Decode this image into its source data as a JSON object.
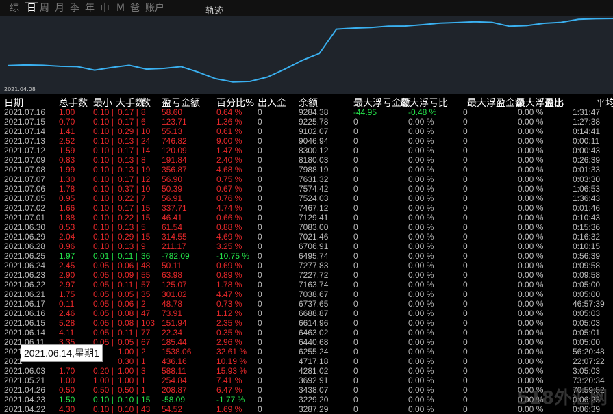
{
  "tabs": [
    "综",
    "日",
    "周",
    "月",
    "季",
    "年",
    "巾",
    "M",
    "爸",
    "账户"
  ],
  "active_tab": 1,
  "chart_title": "轨迹",
  "chart_date_label": "2021.04.08",
  "chart_data": {
    "type": "line",
    "color": "#3ab0f0",
    "x": [
      "2021.04.08",
      "",
      "",
      "",
      "",
      "",
      "",
      "",
      "",
      "",
      "",
      "",
      "",
      "",
      "",
      "",
      "",
      "",
      "",
      "",
      "",
      "",
      "",
      "",
      "",
      "",
      "",
      "",
      "",
      "",
      "",
      "",
      "",
      "",
      "",
      ""
    ],
    "values": [
      3287,
      3320,
      3300,
      3250,
      3230,
      3050,
      3190,
      3300,
      3100,
      3140,
      3230,
      2950,
      2620,
      2450,
      2480,
      2700,
      3100,
      3550,
      3900,
      5150,
      5200,
      5230,
      5300,
      5310,
      5380,
      5460,
      5490,
      5530,
      5500,
      5300,
      5330,
      5450,
      5500,
      5650,
      5680,
      5690
    ]
  },
  "columns": [
    "日期",
    "总手数",
    "最小",
    "大手数",
    "数",
    "盈亏金额",
    "百分比%",
    "出入金",
    "余额",
    "最大浮亏金额",
    "最大浮亏比",
    "最大浮盈金额",
    "最大浮盈比",
    "最小",
    "平均"
  ],
  "rows": [
    {
      "date": "2021.07.16",
      "lots": "1.00",
      "min": "0.10",
      "max": "0.17",
      "n": "8",
      "pl": "58.60",
      "pct": "0.64 %",
      "io": "0",
      "bal": "9284.38",
      "mfl": "-44.95",
      "mflp": "-0.48 %",
      "mfp": "0",
      "mfpp": "0.00 %",
      "t": "1:31:47",
      "cls": "red",
      "mflcls": "green"
    },
    {
      "date": "2021.07.15",
      "lots": "0.70",
      "min": "0.10",
      "max": "0.17",
      "n": "6",
      "pl": "123.71",
      "pct": "1.36 %",
      "io": "0",
      "bal": "9225.78",
      "mfl": "0",
      "mflp": "0.00 %",
      "mfp": "0",
      "mfpp": "0.00 %",
      "t": "1:27:38",
      "cls": "red"
    },
    {
      "date": "2021.07.14",
      "lots": "1.41",
      "min": "0.10",
      "max": "0.29",
      "n": "10",
      "pl": "55.13",
      "pct": "0.61 %",
      "io": "0",
      "bal": "9102.07",
      "mfl": "0",
      "mflp": "0.00 %",
      "mfp": "0",
      "mfpp": "0.00 %",
      "t": "0:14:41",
      "cls": "red"
    },
    {
      "date": "2021.07.13",
      "lots": "2.52",
      "min": "0.10",
      "max": "0.13",
      "n": "24",
      "pl": "746.82",
      "pct": "9.00 %",
      "io": "0",
      "bal": "9046.94",
      "mfl": "0",
      "mflp": "0.00 %",
      "mfp": "0",
      "mfpp": "0.00 %",
      "t": "0:00:11",
      "cls": "red"
    },
    {
      "date": "2021.07.12",
      "lots": "1.59",
      "min": "0.10",
      "max": "0.17",
      "n": "14",
      "pl": "120.09",
      "pct": "1.47 %",
      "io": "0",
      "bal": "8300.12",
      "mfl": "0",
      "mflp": "0.00 %",
      "mfp": "0",
      "mfpp": "0.00 %",
      "t": "0:00:43",
      "cls": "red"
    },
    {
      "date": "2021.07.09",
      "lots": "0.83",
      "min": "0.10",
      "max": "0.13",
      "n": "8",
      "pl": "191.84",
      "pct": "2.40 %",
      "io": "0",
      "bal": "8180.03",
      "mfl": "0",
      "mflp": "0.00 %",
      "mfp": "0",
      "mfpp": "0.00 %",
      "t": "0:26:39",
      "cls": "red"
    },
    {
      "date": "2021.07.08",
      "lots": "1.99",
      "min": "0.10",
      "max": "0.13",
      "n": "19",
      "pl": "356.87",
      "pct": "4.68 %",
      "io": "0",
      "bal": "7988.19",
      "mfl": "0",
      "mflp": "0.00 %",
      "mfp": "0",
      "mfpp": "0.00 %",
      "t": "0:01:33",
      "cls": "red"
    },
    {
      "date": "2021.07.07",
      "lots": "1.30",
      "min": "0.10",
      "max": "0.17",
      "n": "12",
      "pl": "56.90",
      "pct": "0.75 %",
      "io": "0",
      "bal": "7631.32",
      "mfl": "0",
      "mflp": "0.00 %",
      "mfp": "0",
      "mfpp": "0.00 %",
      "t": "0:03:30",
      "cls": "red"
    },
    {
      "date": "2021.07.06",
      "lots": "1.78",
      "min": "0.10",
      "max": "0.37",
      "n": "10",
      "pl": "50.39",
      "pct": "0.67 %",
      "io": "0",
      "bal": "7574.42",
      "mfl": "0",
      "mflp": "0.00 %",
      "mfp": "0",
      "mfpp": "0.00 %",
      "t": "1:06:53",
      "cls": "red"
    },
    {
      "date": "2021.07.05",
      "lots": "0.95",
      "min": "0.10",
      "max": "0.22",
      "n": "7",
      "pl": "56.91",
      "pct": "0.76 %",
      "io": "0",
      "bal": "7524.03",
      "mfl": "0",
      "mflp": "0.00 %",
      "mfp": "0",
      "mfpp": "0.00 %",
      "t": "1:36:43",
      "cls": "red"
    },
    {
      "date": "2021.07.02",
      "lots": "1.66",
      "min": "0.10",
      "max": "0.17",
      "n": "15",
      "pl": "337.71",
      "pct": "4.74 %",
      "io": "0",
      "bal": "7467.12",
      "mfl": "0",
      "mflp": "0.00 %",
      "mfp": "0",
      "mfpp": "0.00 %",
      "t": "0:01:46",
      "cls": "red"
    },
    {
      "date": "2021.07.01",
      "lots": "1.88",
      "min": "0.10",
      "max": "0.22",
      "n": "15",
      "pl": "46.41",
      "pct": "0.66 %",
      "io": "0",
      "bal": "7129.41",
      "mfl": "0",
      "mflp": "0.00 %",
      "mfp": "0",
      "mfpp": "0.00 %",
      "t": "0:10:43",
      "cls": "red"
    },
    {
      "date": "2021.06.30",
      "lots": "0.53",
      "min": "0.10",
      "max": "0.13",
      "n": "5",
      "pl": "61.54",
      "pct": "0.88 %",
      "io": "0",
      "bal": "7083.00",
      "mfl": "0",
      "mflp": "0.00 %",
      "mfp": "0",
      "mfpp": "0.00 %",
      "t": "0:15:36",
      "cls": "red"
    },
    {
      "date": "2021.06.29",
      "lots": "2.04",
      "min": "0.10",
      "max": "0.29",
      "n": "15",
      "pl": "314.55",
      "pct": "4.69 %",
      "io": "0",
      "bal": "7021.46",
      "mfl": "0",
      "mflp": "0.00 %",
      "mfp": "0",
      "mfpp": "0.00 %",
      "t": "0:16:32",
      "cls": "red"
    },
    {
      "date": "2021.06.28",
      "lots": "0.96",
      "min": "0.10",
      "max": "0.13",
      "n": "9",
      "pl": "211.17",
      "pct": "3.25 %",
      "io": "0",
      "bal": "6706.91",
      "mfl": "0",
      "mflp": "0.00 %",
      "mfp": "0",
      "mfpp": "0.00 %",
      "t": "0:10:15",
      "cls": "red"
    },
    {
      "date": "2021.06.25",
      "lots": "1.97",
      "min": "0.01",
      "max": "0.11",
      "n": "36",
      "pl": "-782.09",
      "pct": "-10.75 %",
      "io": "0",
      "bal": "6495.74",
      "mfl": "0",
      "mflp": "0.00 %",
      "mfp": "0",
      "mfpp": "0.00 %",
      "t": "0:56:39",
      "cls": "green"
    },
    {
      "date": "2021.06.24",
      "lots": "2.45",
      "min": "0.05",
      "max": "0.06",
      "n": "48",
      "pl": "50.11",
      "pct": "0.69 %",
      "io": "0",
      "bal": "7277.83",
      "mfl": "0",
      "mflp": "0.00 %",
      "mfp": "0",
      "mfpp": "0.00 %",
      "t": "0:09:58",
      "cls": "red"
    },
    {
      "date": "2021.06.23",
      "lots": "2.90",
      "min": "0.05",
      "max": "0.09",
      "n": "55",
      "pl": "63.98",
      "pct": "0.89 %",
      "io": "0",
      "bal": "7227.72",
      "mfl": "0",
      "mflp": "0.00 %",
      "mfp": "0",
      "mfpp": "0.00 %",
      "t": "0:09:58",
      "cls": "red"
    },
    {
      "date": "2021.06.22",
      "lots": "2.97",
      "min": "0.05",
      "max": "0.11",
      "n": "57",
      "pl": "125.07",
      "pct": "1.78 %",
      "io": "0",
      "bal": "7163.74",
      "mfl": "0",
      "mflp": "0.00 %",
      "mfp": "0",
      "mfpp": "0.00 %",
      "t": "0:05:00",
      "cls": "red"
    },
    {
      "date": "2021.06.21",
      "lots": "1.75",
      "min": "0.05",
      "max": "0.05",
      "n": "35",
      "pl": "301.02",
      "pct": "4.47 %",
      "io": "0",
      "bal": "7038.67",
      "mfl": "0",
      "mflp": "0.00 %",
      "mfp": "0",
      "mfpp": "0.00 %",
      "t": "0:05:00",
      "cls": "red"
    },
    {
      "date": "2021.06.17",
      "lots": "0.11",
      "min": "0.05",
      "max": "0.06",
      "n": "2",
      "pl": "48.78",
      "pct": "0.73 %",
      "io": "0",
      "bal": "6737.65",
      "mfl": "0",
      "mflp": "0.00 %",
      "mfp": "0",
      "mfpp": "0.00 %",
      "t": "46:57:39",
      "cls": "red"
    },
    {
      "date": "2021.06.16",
      "lots": "2.46",
      "min": "0.05",
      "max": "0.08",
      "n": "47",
      "pl": "73.91",
      "pct": "1.12 %",
      "io": "0",
      "bal": "6688.87",
      "mfl": "0",
      "mflp": "0.00 %",
      "mfp": "0",
      "mfpp": "0.00 %",
      "t": "0:05:03",
      "cls": "red"
    },
    {
      "date": "2021.06.15",
      "lots": "5.28",
      "min": "0.05",
      "max": "0.08",
      "n": "103",
      "pl": "151.94",
      "pct": "2.35 %",
      "io": "0",
      "bal": "6614.96",
      "mfl": "0",
      "mflp": "0.00 %",
      "mfp": "0",
      "mfpp": "0.00 %",
      "t": "0:05:03",
      "cls": "red"
    },
    {
      "date": "2021.06.14",
      "lots": "4.11",
      "min": "0.05",
      "max": "0.11",
      "n": "77",
      "pl": "22.34",
      "pct": "0.35 %",
      "io": "0",
      "bal": "6463.02",
      "mfl": "0",
      "mflp": "0.00 %",
      "mfp": "0",
      "mfpp": "0.00 %",
      "t": "0:05:01",
      "cls": "red"
    },
    {
      "date": "2021.06.11",
      "lots": "3.35",
      "min": "0.05",
      "max": "0.05",
      "n": "67",
      "pl": "185.44",
      "pct": "2.96 %",
      "io": "0",
      "bal": "6440.68",
      "mfl": "0",
      "mflp": "0.00 %",
      "mfp": "0",
      "mfpp": "0.00 %",
      "t": "0:05:00",
      "cls": "red"
    },
    {
      "date": "2021",
      "lots": "",
      "min": "",
      "max": "1.00",
      "n": "2",
      "pl": "1538.06",
      "pct": "32.61 %",
      "io": "0",
      "bal": "6255.24",
      "mfl": "0",
      "mflp": "0.00 %",
      "mfp": "0",
      "mfpp": "0.00 %",
      "t": "56:20:48",
      "cls": "red"
    },
    {
      "date": "2021",
      "lots": "",
      "min": "",
      "max": "0.30",
      "n": "1",
      "pl": "436.16",
      "pct": "10.19 %",
      "io": "0",
      "bal": "4717.18",
      "mfl": "0",
      "mflp": "0.00 %",
      "mfp": "0",
      "mfpp": "0.00 %",
      "t": "22:07:22",
      "cls": "red"
    },
    {
      "date": "2021.06.03",
      "lots": "1.70",
      "min": "0.20",
      "max": "1.00",
      "n": "3",
      "pl": "588.11",
      "pct": "15.93 %",
      "io": "0",
      "bal": "4281.02",
      "mfl": "0",
      "mflp": "0.00 %",
      "mfp": "0",
      "mfpp": "0.00 %",
      "t": "3:05:03",
      "cls": "red"
    },
    {
      "date": "2021.05.21",
      "lots": "1.00",
      "min": "1.00",
      "max": "1.00",
      "n": "1",
      "pl": "254.84",
      "pct": "7.41 %",
      "io": "0",
      "bal": "3692.91",
      "mfl": "0",
      "mflp": "0.00 %",
      "mfp": "0",
      "mfpp": "0.00 %",
      "t": "73:20:34",
      "cls": "red"
    },
    {
      "date": "2021.04.26",
      "lots": "0.50",
      "min": "0.50",
      "max": "0.50",
      "n": "1",
      "pl": "208.87",
      "pct": "6.47 %",
      "io": "0",
      "bal": "3438.07",
      "mfl": "0",
      "mflp": "0.00 %",
      "mfp": "0",
      "mfpp": "0.00 %",
      "t": "70:59:52",
      "cls": "red"
    },
    {
      "date": "2021.04.23",
      "lots": "1.50",
      "min": "0.10",
      "max": "0.10",
      "n": "15",
      "pl": "-58.09",
      "pct": "-1.77 %",
      "io": "0",
      "bal": "3229.20",
      "mfl": "0",
      "mflp": "0.00 %",
      "mfp": "0",
      "mfpp": "0.00 %",
      "t": "0:06:23",
      "cls": "green"
    },
    {
      "date": "2021.04.22",
      "lots": "4.30",
      "min": "0.10",
      "max": "0.10",
      "n": "43",
      "pl": "54.52",
      "pct": "1.69 %",
      "io": "0",
      "bal": "3287.29",
      "mfl": "0",
      "mflp": "0.00 %",
      "mfp": "0",
      "mfpp": "0.00 %",
      "t": "0:06:39",
      "cls": "red"
    }
  ],
  "tooltip": "2021.06.14,星期1",
  "watermark": "518外汇网"
}
